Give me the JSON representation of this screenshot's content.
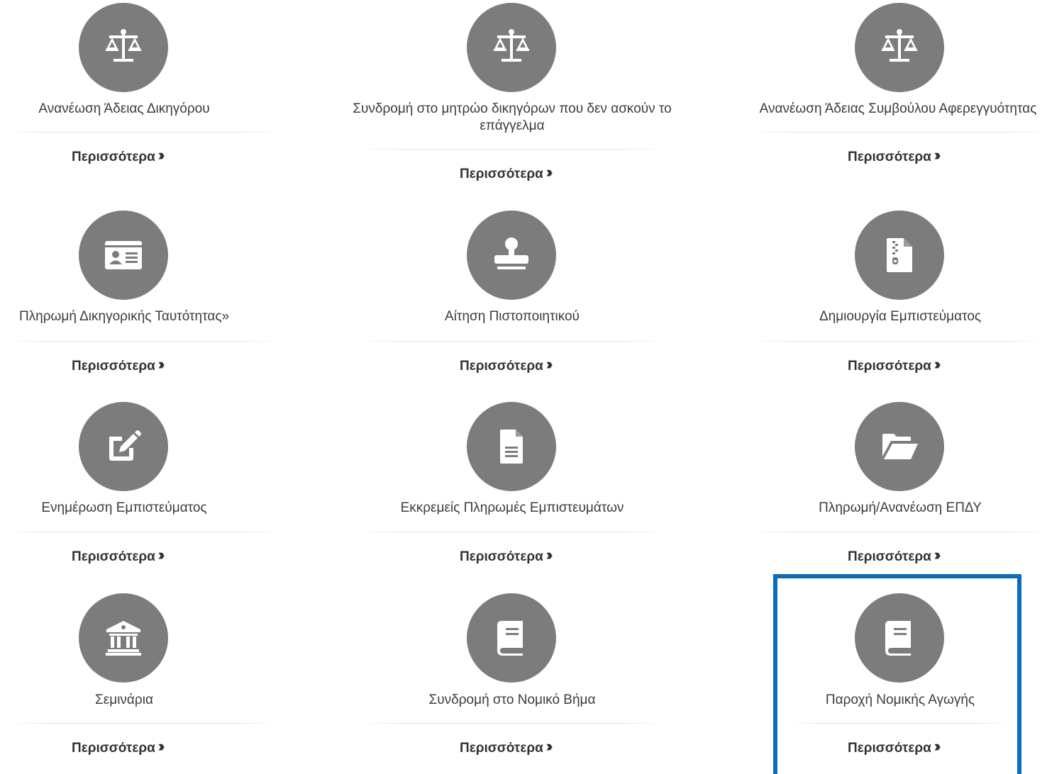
{
  "more_label": "Περισσότερα",
  "more_chevron": "»",
  "cards": [
    {
      "title": "Ανανέωση Άδειας Δικηγόρου",
      "icon": "scale-icon"
    },
    {
      "title": "Συνδρομή στο μητρώο δικηγόρων που δεν ασκούν το επάγγελμα",
      "icon": "scale-icon"
    },
    {
      "title": "Ανανέωση Άδειας Συμβούλου Αφερεγγυότητας",
      "icon": "scale-icon"
    },
    {
      "title": "Πληρωμή Δικηγορικής Ταυτότητας»",
      "icon": "id-card-icon"
    },
    {
      "title": "Αίτηση Πιστοποιητικού",
      "icon": "stamp-icon"
    },
    {
      "title": "Δημιουργία Εμπιστεύματος",
      "icon": "file-zipper-icon"
    },
    {
      "title": "Ενημέρωση Εμπιστεύματος",
      "icon": "edit-icon"
    },
    {
      "title": "Εκκρεμείς Πληρωμές Εμπιστευμάτων",
      "icon": "file-lines-icon"
    },
    {
      "title": "Πληρωμή/Ανανέωση ΕΠΔΥ",
      "icon": "folder-open-icon"
    },
    {
      "title": "Σεμινάρια",
      "icon": "landmark-icon"
    },
    {
      "title": "Συνδρομή στο Νομικό Βήμα",
      "icon": "book-icon"
    },
    {
      "title": "Παροχή Νομικής Αγωγής",
      "icon": "book-icon"
    }
  ],
  "colors": {
    "icon_bg": "#7c7c7c",
    "highlight": "#0a6cbd",
    "text": "#3c3c3c"
  }
}
